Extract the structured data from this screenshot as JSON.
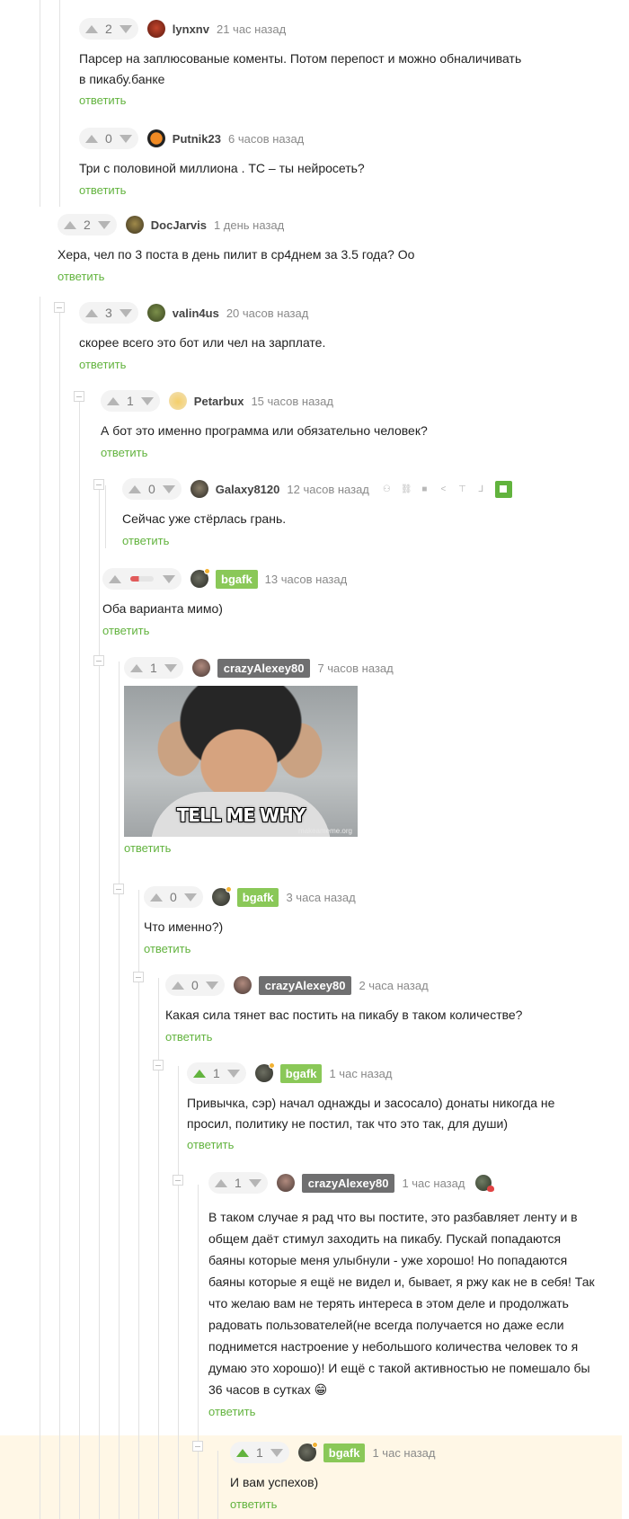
{
  "actions": {
    "reply": "ответить"
  },
  "comments": {
    "lynxnv": {
      "score": "2",
      "author": "lynxnv",
      "time": "21 час назад",
      "text_line1": "Парсер на заплюсованые коменты. Потом перепост и можно обналичивать",
      "text_line2": "в пикабу.банке"
    },
    "putnik": {
      "score": "0",
      "author": "Putnik23",
      "time": "6 часов назад",
      "text": "Три с половиной миллиона . ТС – ты нейросеть?"
    },
    "docjarvis": {
      "score": "2",
      "author": "DocJarvis",
      "time": "1 день назад",
      "text": "Хера, чел по 3 поста в день пилит в ср4днем за 3.5 года? Оо"
    },
    "valin": {
      "score": "3",
      "author": "valin4us",
      "time": "20 часов назад",
      "text": "скорее всего это бот или чел на зарплате."
    },
    "petarbux": {
      "score": "1",
      "author": "Petarbux",
      "time": "15 часов назад",
      "text": "А бот это именно программа или обязательно человек?"
    },
    "galaxy": {
      "score": "0",
      "author": "Galaxy8120",
      "time": "12 часов назад",
      "text": "Сейчас уже стёрлась грань."
    },
    "bgafk1": {
      "author": "bgafk",
      "time": "13 часов назад",
      "text": "Оба варианта мимо)"
    },
    "crazy1": {
      "score": "1",
      "author": "crazyAlexey80",
      "time": "7 часов назад",
      "meme_caption": "TELL ME WHY",
      "meme_watermark": "makeameme.org"
    },
    "bgafk2": {
      "score": "0",
      "author": "bgafk",
      "time": "3 часа назад",
      "text": "Что именно?)"
    },
    "crazy2": {
      "score": "0",
      "author": "crazyAlexey80",
      "time": "2 часа назад",
      "text": "Какая сила тянет вас постить на пикабу в таком количестве?"
    },
    "bgafk3": {
      "score": "1",
      "author": "bgafk",
      "time": "1 час назад",
      "text_line1": "Привычка, сэр) начал однажды и засосало) донаты никогда не",
      "text_line2": "просил, политику не постил, так что это так, для души)"
    },
    "crazy3": {
      "score": "1",
      "author": "crazyAlexey80",
      "time": "1 час назад",
      "lines": [
        "В таком случае я рад что вы постите, это разбавляет ленту и в",
        "общем даёт стимул заходить на пикабу. Пускай попадаются",
        "баяны которые меня улыбнули - уже хорошо! Но попадаются",
        "баяны которые я ещё не видел и, бывает, я ржу как не в себя! Так",
        "что желаю вам не терять интереса в этом деле и продолжать",
        "радовать пользователей(не всегда получается но даже если",
        "поднимется настроение у небольшого количества человек то я",
        "думаю это хорошо)! И ещё с такой активностью не помешало бы",
        "36 часов в сутках"
      ],
      "emoji": "😁"
    },
    "bgafk4": {
      "score": "1",
      "author": "bgafk",
      "time": "1 час назад",
      "text": "И вам успехов)"
    }
  },
  "colors": {
    "accent_green": "#62b33e",
    "badge_green": "#8ac858",
    "badge_gray": "#6f6f70",
    "highlight_bg": "#fff7e6"
  },
  "icons": [
    "arrow-up-icon",
    "arrow-down-icon",
    "collapse-icon",
    "archive-icon",
    "link-icon",
    "save-icon",
    "share-icon",
    "scroll-top-icon",
    "branch-icon",
    "flag-icon"
  ]
}
